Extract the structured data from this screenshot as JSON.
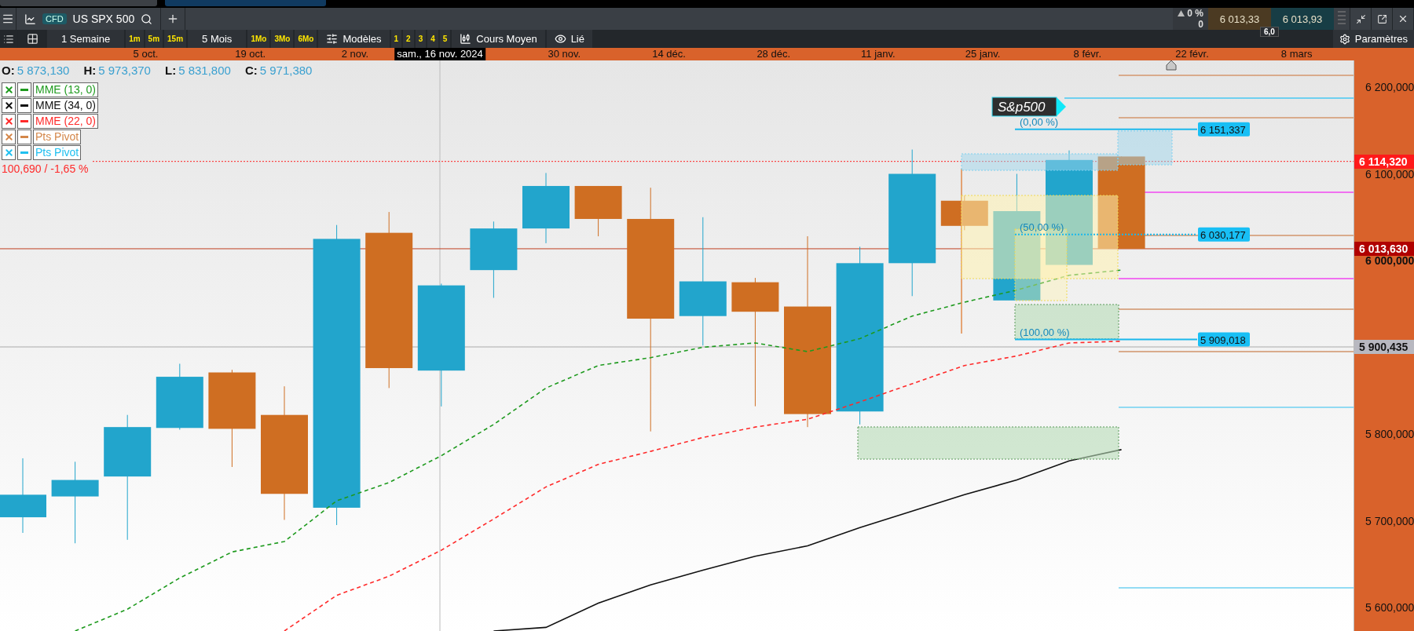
{
  "header": {
    "instrument_type": "CFD",
    "instrument": "US SPX 500",
    "change": "0 %",
    "change_points": "0",
    "bid": "6 013,33",
    "spread": "6,0",
    "ask": "6 013,93"
  },
  "toolbar": [
    {
      "kind": "label",
      "text": "1 Semaine"
    },
    {
      "kind": "chip",
      "text": "1m"
    },
    {
      "kind": "chip",
      "text": "5m"
    },
    {
      "kind": "chip",
      "text": "15m"
    },
    {
      "kind": "label",
      "text": "5 Mois"
    },
    {
      "kind": "chip",
      "text": "1Mo"
    },
    {
      "kind": "chip",
      "text": "3Mo"
    },
    {
      "kind": "chip",
      "text": "6Mo"
    },
    {
      "kind": "templates",
      "text": "Modèles"
    },
    {
      "kind": "chip",
      "text": "1"
    },
    {
      "kind": "chip",
      "text": "2"
    },
    {
      "kind": "chip",
      "text": "3"
    },
    {
      "kind": "chip",
      "text": "4"
    },
    {
      "kind": "chip",
      "text": "5"
    },
    {
      "kind": "average",
      "text": "Cours Moyen"
    },
    {
      "kind": "link",
      "text": "Lié"
    }
  ],
  "settings_label": "Paramètres",
  "date_labels": [
    "5 oct.",
    "19 oct.",
    "2 nov.",
    "30 nov.",
    "14 déc.",
    "28 déc.",
    "11 janv.",
    "25 janv.",
    "8 févr.",
    "22 févr.",
    "8 mars"
  ],
  "cursor_date": "sam., 16 nov. 2024",
  "ohlc": [
    {
      "label": "O:",
      "value": "5 873,130"
    },
    {
      "label": "H:",
      "value": "5 973,370"
    },
    {
      "label": "L:",
      "value": "5 831,800"
    },
    {
      "label": "C:",
      "value": "5 971,380"
    }
  ],
  "indicators": [
    {
      "label": "MME (13, 0)",
      "color": "#1e9a1e"
    },
    {
      "label": "MME (34, 0)",
      "color": "#111111"
    },
    {
      "label": "MME (22, 0)",
      "color": "#ff2a2a"
    },
    {
      "label": "Pts Pivot",
      "color": "#d4874a"
    },
    {
      "label": "Pts Pivot",
      "color": "#20c0f0"
    }
  ],
  "alert_label": "100,690 / -1,65 %",
  "drawing_label": "S&p500",
  "fib_levels": [
    {
      "ratio": "(0,00 %)",
      "price": "6 151,337"
    },
    {
      "ratio": "(50,00 %)",
      "price": "6 030,177"
    },
    {
      "ratio": "(100,00 %)",
      "price": "5 909,018"
    }
  ],
  "price_ticks": [
    {
      "label": "6 200,000",
      "bold": false
    },
    {
      "label": "6 100,000",
      "bold": false
    },
    {
      "label": "6 000,000",
      "bold": true
    },
    {
      "label": "5 800,000",
      "bold": false
    },
    {
      "label": "5 700,000",
      "bold": false
    },
    {
      "label": "5 600,000",
      "bold": false
    }
  ],
  "price_tags": [
    {
      "kind": "alert",
      "text": "6 114,320"
    },
    {
      "kind": "last",
      "text": "6 013,630"
    },
    {
      "kind": "cursor",
      "text": "5 900,435"
    }
  ]
}
